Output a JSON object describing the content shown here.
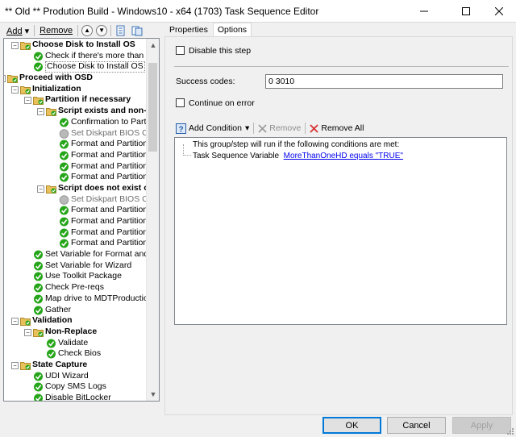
{
  "window": {
    "title": "** Old ** Prodution Build - Windows10 - x64 (1703) Task Sequence Editor",
    "min_icon": "minimize-icon",
    "max_icon": "maximize-icon",
    "close_icon": "close-icon"
  },
  "left_toolbar": {
    "add_label": "Add",
    "remove_label": "Remove"
  },
  "tree": {
    "items": [
      {
        "label": "Choose Disk to Install OS",
        "bold": true,
        "icon": "folder",
        "indent": 1,
        "expander": "-"
      },
      {
        "label": "Check if there's more than one H",
        "icon": "check",
        "indent": 2
      },
      {
        "label": "Choose Disk to Install OS",
        "icon": "check",
        "indent": 2,
        "selected": true
      },
      {
        "label": "Proceed with OSD",
        "bold": true,
        "icon": "folder",
        "indent": 0,
        "expander": "-"
      },
      {
        "label": "Initialization",
        "bold": true,
        "icon": "folder",
        "indent": 1,
        "expander": "-"
      },
      {
        "label": "Partition if necessary",
        "bold": true,
        "icon": "folder",
        "indent": 2,
        "expander": "-"
      },
      {
        "label": "Script exists and non-N",
        "bold": true,
        "icon": "folder",
        "indent": 3,
        "expander": "-"
      },
      {
        "label": "Confirmation to Partition",
        "icon": "check",
        "indent": 4
      },
      {
        "label": "Set Diskpart BIOS Comp",
        "icon": "gray",
        "indent": 4,
        "disabled": true
      },
      {
        "label": "Format and Partition Disk",
        "icon": "check",
        "indent": 4
      },
      {
        "label": "Format and Partition Disk",
        "icon": "check",
        "indent": 4
      },
      {
        "label": "Format and Partition Disk",
        "icon": "check",
        "indent": 4
      },
      {
        "label": "Format and Partition Disk",
        "icon": "check",
        "indent": 4
      },
      {
        "label": "Script does not exist or",
        "bold": true,
        "icon": "folder",
        "indent": 3,
        "expander": "-"
      },
      {
        "label": "Set Diskpart BIOS Comp",
        "icon": "gray",
        "indent": 4,
        "disabled": true
      },
      {
        "label": "Format and Partition Disk",
        "icon": "check",
        "indent": 4
      },
      {
        "label": "Format and Partition Disk",
        "icon": "check",
        "indent": 4
      },
      {
        "label": "Format and Partition Disk",
        "icon": "check",
        "indent": 4
      },
      {
        "label": "Format and Partition Disk",
        "icon": "check",
        "indent": 4
      },
      {
        "label": "Set Variable for Format and Partit",
        "icon": "check",
        "indent": 2
      },
      {
        "label": "Set Variable for Wizard",
        "icon": "check",
        "indent": 2
      },
      {
        "label": "Use Toolkit Package",
        "icon": "check",
        "indent": 2
      },
      {
        "label": "Check Pre-reqs",
        "icon": "check",
        "indent": 2
      },
      {
        "label": "Map drive to MDTProduction$",
        "icon": "check",
        "indent": 2
      },
      {
        "label": "Gather",
        "icon": "check",
        "indent": 2
      },
      {
        "label": "Validation",
        "bold": true,
        "icon": "folder",
        "indent": 1,
        "expander": "-"
      },
      {
        "label": "Non-Replace",
        "bold": true,
        "icon": "folder",
        "indent": 2,
        "expander": "-"
      },
      {
        "label": "Validate",
        "icon": "check",
        "indent": 3
      },
      {
        "label": "Check Bios",
        "icon": "check",
        "indent": 3
      },
      {
        "label": "State Capture",
        "bold": true,
        "icon": "folder",
        "indent": 1,
        "expander": "-"
      },
      {
        "label": "UDI Wizard",
        "icon": "check",
        "indent": 2
      },
      {
        "label": "Copy SMS Logs",
        "icon": "check",
        "indent": 2
      },
      {
        "label": "Disable BitLocker",
        "icon": "check",
        "indent": 2
      }
    ]
  },
  "tabs": [
    {
      "label": "Properties",
      "active": false
    },
    {
      "label": "Options",
      "active": true
    }
  ],
  "options": {
    "disable_step_label": "Disable this step",
    "disable_step_checked": false,
    "success_codes_label": "Success codes:",
    "success_codes_value": "0 3010",
    "continue_on_error_label": "Continue on error",
    "continue_on_error_checked": false
  },
  "conditions": {
    "add_condition_label": "Add Condition",
    "remove_label": "Remove",
    "remove_all_label": "Remove All",
    "header_text": "This group/step will run if the following conditions are met:",
    "condition_prefix": "Task Sequence Variable",
    "condition_link": "MoreThanOneHD equals \"TRUE\""
  },
  "buttons": {
    "ok": "OK",
    "cancel": "Cancel",
    "apply": "Apply"
  },
  "colors": {
    "check_green": "#26a51a",
    "folder_yellow": "#e8c15a",
    "link_blue": "#0000ee",
    "remove_red": "#d83030"
  }
}
